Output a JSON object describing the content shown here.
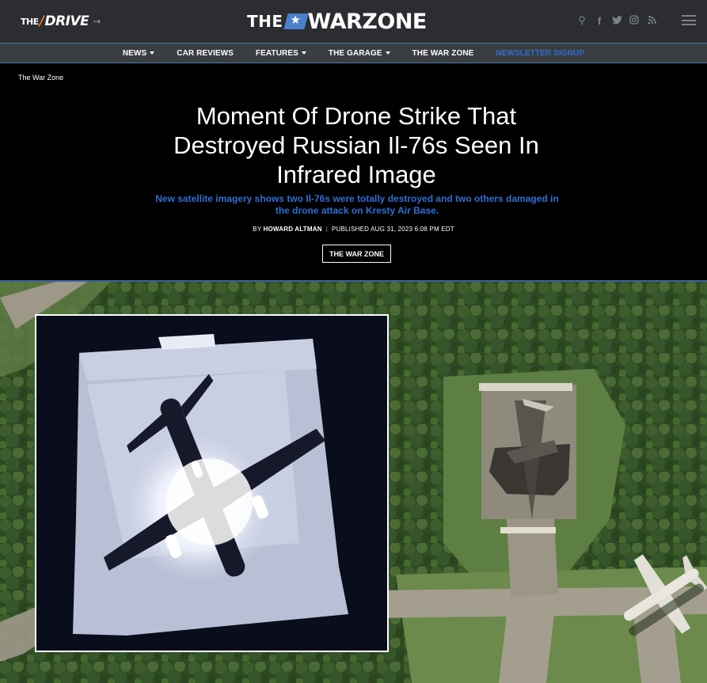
{
  "header": {
    "drive_logo_prefix": "THE",
    "drive_logo_word": "DRIVE",
    "drive_logo_arrow": "→",
    "warzone_logo_prefix": "THE",
    "warzone_logo_word": "WARZONE",
    "icons": [
      "search-icon",
      "facebook-icon",
      "twitter-icon",
      "instagram-icon",
      "rss-icon",
      "menu-icon"
    ],
    "social_glyphs": {
      "search": "⚲",
      "facebook": "f",
      "twitter": "🐦",
      "instagram": "◎",
      "rss": "⋑"
    }
  },
  "nav": {
    "items": [
      {
        "label": "NEWS",
        "dropdown": true
      },
      {
        "label": "CAR REVIEWS",
        "dropdown": false
      },
      {
        "label": "FEATURES",
        "dropdown": true
      },
      {
        "label": "THE GARAGE",
        "dropdown": true
      },
      {
        "label": "THE WAR ZONE",
        "dropdown": false
      },
      {
        "label": "NEWSLETTER SIGNUP",
        "dropdown": false
      }
    ]
  },
  "article": {
    "breadcrumb": "The War Zone",
    "title": "Moment Of Drone Strike That Destroyed Russian Il-76s Seen In Infrared Image",
    "dek": "New satellite imagery shows two Il-76s were totally destroyed and two others damaged in the drone attack on Kresty Air Base.",
    "byline_prefix": "BY",
    "author": "HOWARD ALTMAN",
    "separator": "|",
    "published": "PUBLISHED AUG 31, 2023 6:08 PM EDT",
    "tag": "THE WAR ZONE"
  },
  "colors": {
    "accent_blue": "#2e6fd2",
    "header_bg": "#2b2d31",
    "nav_bg": "#3a3d42",
    "drive_orange": "#e8772e"
  }
}
